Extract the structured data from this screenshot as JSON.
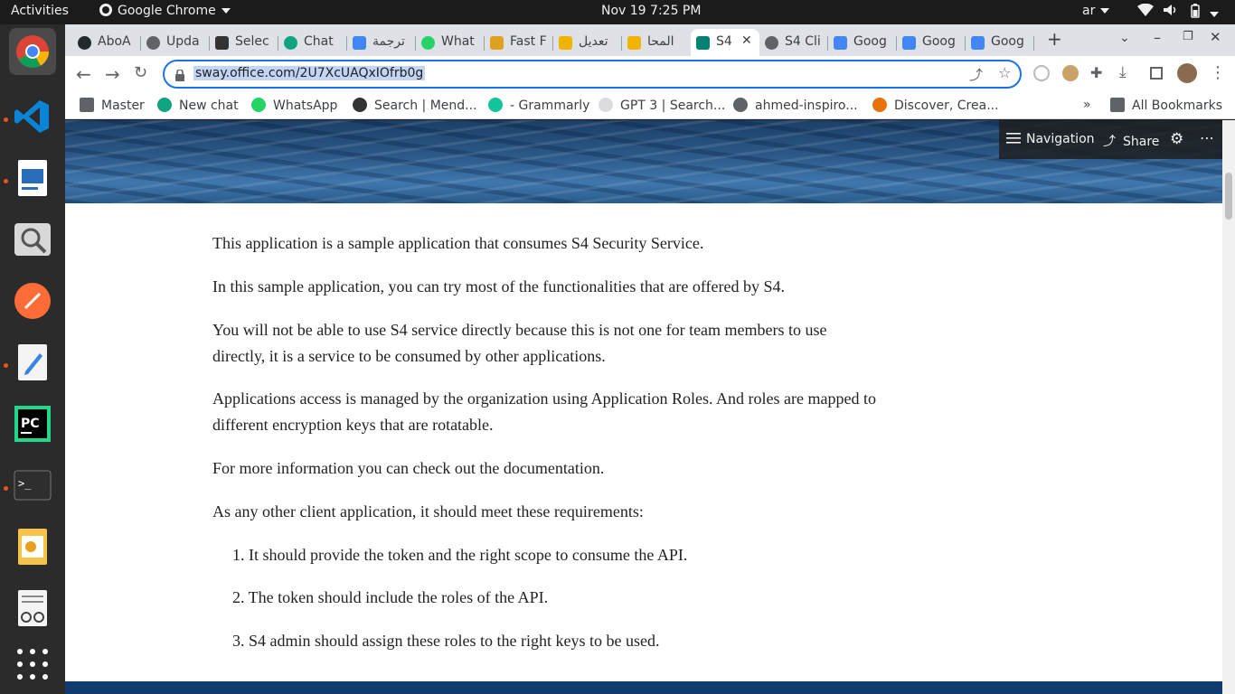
{
  "topbar": {
    "activities": "Activities",
    "app_name": "Google Chrome",
    "clock": "Nov 19  7:25 PM",
    "language": "ar"
  },
  "tabs": [
    {
      "label": "AboA",
      "color": "#24292e"
    },
    {
      "label": "Upda",
      "color": "#5f6368"
    },
    {
      "label": "Selec",
      "color": "#333333"
    },
    {
      "label": "Chat",
      "color": "#10a37f"
    },
    {
      "label": "ترجمة",
      "color": "#4285f4"
    },
    {
      "label": "What",
      "color": "#25d366"
    },
    {
      "label": "Fast F",
      "color": "#e0a020"
    },
    {
      "label": "تعديل",
      "color": "#f0b400"
    },
    {
      "label": "المحا",
      "color": "#f0b400"
    },
    {
      "label": "S4",
      "color": "#008272"
    },
    {
      "label": "S4 Cli",
      "color": "#5f6368"
    },
    {
      "label": "Goog",
      "color": "#4285f4"
    },
    {
      "label": "Goog",
      "color": "#4285f4"
    },
    {
      "label": "Goog",
      "color": "#4285f4"
    }
  ],
  "address": {
    "url": "sway.office.com/2U7XcUAQxIOfrb0g"
  },
  "bookmarks": [
    {
      "label": "Master",
      "color": "#5f6368"
    },
    {
      "label": "New chat",
      "color": "#10a37f"
    },
    {
      "label": "WhatsApp",
      "color": "#25d366"
    },
    {
      "label": "Search | Mend...",
      "color": "#333333"
    },
    {
      "label": "- Grammarly",
      "color": "#15c39a"
    },
    {
      "label": "GPT 3 | Search...",
      "color": "#9aa0a6"
    },
    {
      "label": "ahmed-inspiro...",
      "color": "#5f6368"
    },
    {
      "label": "Discover, Crea...",
      "color": "#e8710a"
    }
  ],
  "bookmarks_overflow": "»",
  "all_bookmarks": "All Bookmarks",
  "sway": {
    "navigation": "Navigation",
    "share": "Share"
  },
  "content": {
    "p1": "This application is a sample application that consumes S4 Security Service.",
    "p2": "In this sample application, you can try most of the functionalities that are offered by S4.",
    "p3": "You will not be able to use S4 service directly because this is not one for team members to use directly, it is a service to be consumed by other applications.",
    "p4": "Applications access is managed by the organization using Application Roles. And roles are mapped to different encryption keys that are rotatable.",
    "p5": "For more information you can check out the documentation.",
    "p6": "As any other client application, it should meet these requirements:",
    "list": [
      "1. It should provide the token and the right scope to consume the API.",
      "2. The token should include the roles of the API.",
      "3. S4 admin should assign these roles to the right keys to be used."
    ]
  }
}
